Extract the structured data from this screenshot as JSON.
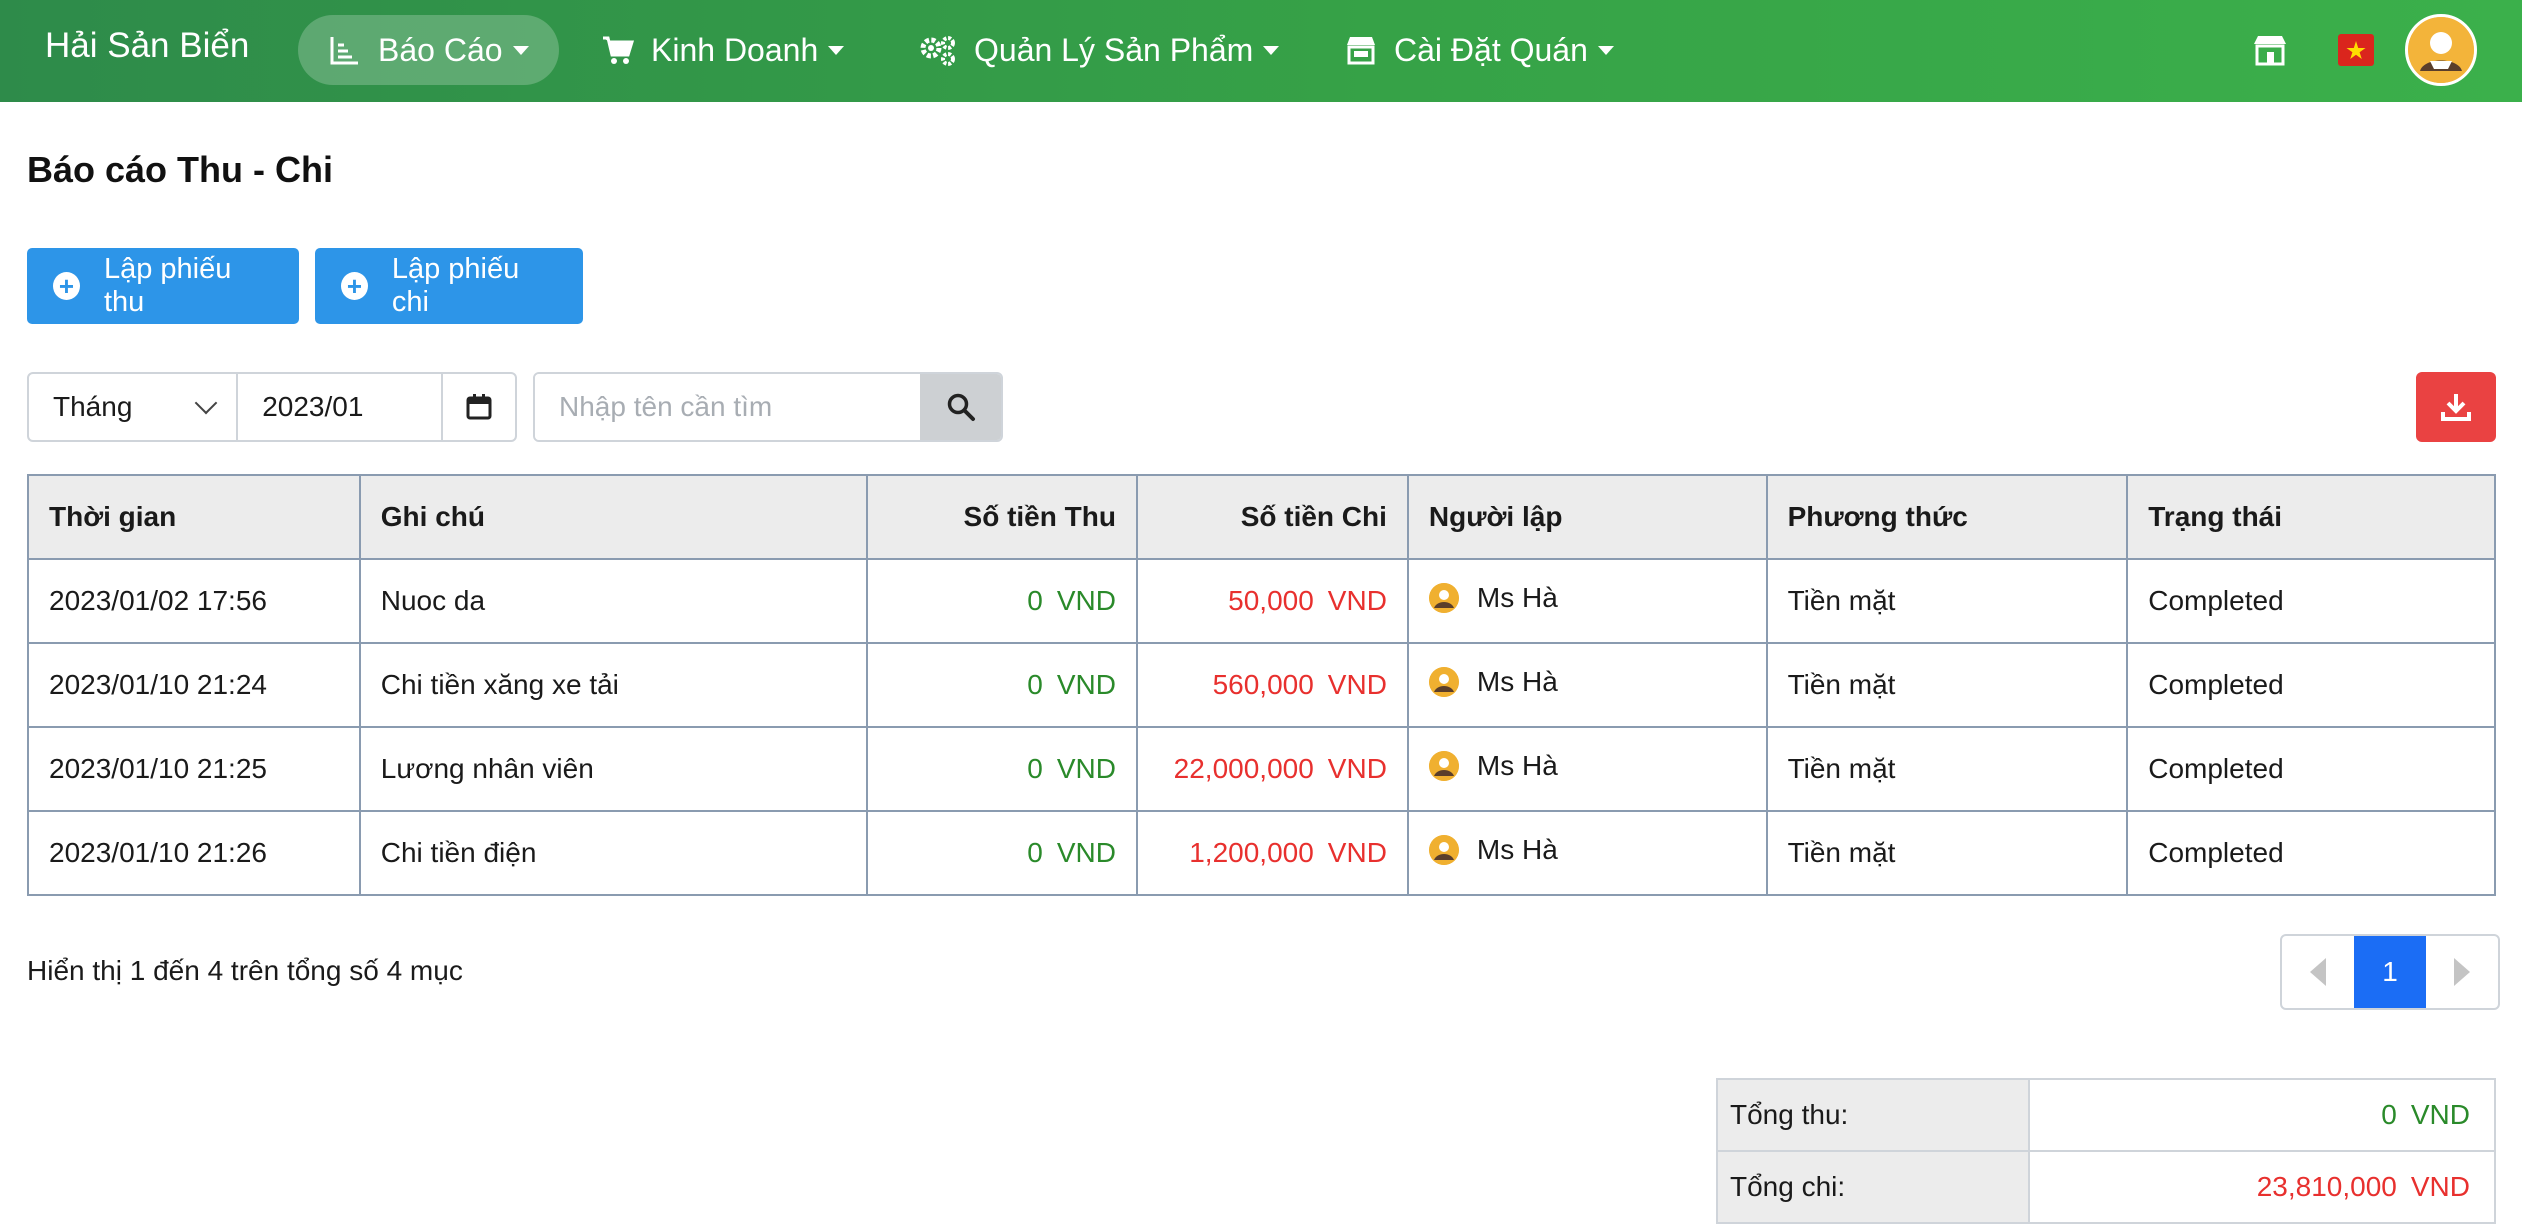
{
  "nav": {
    "brand": "Hải Sản Biển",
    "items": [
      {
        "label": "Báo Cáo",
        "icon": "chart-icon"
      },
      {
        "label": "Kinh Doanh",
        "icon": "cart-icon"
      },
      {
        "label": "Quản Lý Sản Phẩm",
        "icon": "gears-icon"
      },
      {
        "label": "Cài Đặt Quán",
        "icon": "store-icon"
      }
    ],
    "right_icons": [
      "store-icon",
      "vietnam-flag-icon",
      "avatar"
    ]
  },
  "page": {
    "title": "Báo cáo Thu - Chi"
  },
  "actions": {
    "receipt_label": "Lập phiếu thu",
    "payment_label": "Lập phiếu chi"
  },
  "filters": {
    "period": "Tháng",
    "date": "2023/01",
    "search_placeholder": "Nhập tên cần tìm"
  },
  "table": {
    "headers": [
      "Thời gian",
      "Ghi chú",
      "Số tiền Thu",
      "Số tiền Chi",
      "Người lập",
      "Phương thức",
      "Trạng thái"
    ],
    "currency": "VND",
    "rows": [
      {
        "time": "2023/01/02 17:56",
        "note": "Nuoc da",
        "income": "0",
        "expense": "50,000",
        "creator": "Ms Hà",
        "method": "Tiền mặt",
        "status": "Completed"
      },
      {
        "time": "2023/01/10 21:24",
        "note": "Chi tiền xăng xe tải",
        "income": "0",
        "expense": "560,000",
        "creator": "Ms Hà",
        "method": "Tiền mặt",
        "status": "Completed"
      },
      {
        "time": "2023/01/10 21:25",
        "note": "Lương nhân viên",
        "income": "0",
        "expense": "22,000,000",
        "creator": "Ms Hà",
        "method": "Tiền mặt",
        "status": "Completed"
      },
      {
        "time": "2023/01/10 21:26",
        "note": "Chi tiền điện",
        "income": "0",
        "expense": "1,200,000",
        "creator": "Ms Hà",
        "method": "Tiền mặt",
        "status": "Completed"
      }
    ]
  },
  "footer": {
    "summary": "Hiển thị 1 đến 4 trên tổng số 4 mục",
    "current_page": "1"
  },
  "totals": {
    "income_label": "Tổng thu:",
    "income_value": "0",
    "expense_label": "Tổng chi:",
    "expense_value": "23,810,000",
    "currency": "VND"
  },
  "colors": {
    "navbar": "#36a247",
    "primary_button": "#2d95e8",
    "download_button": "#ea4242",
    "income": "#2a8a2a",
    "expense": "#e8302e",
    "page_active": "#1b6df5"
  }
}
